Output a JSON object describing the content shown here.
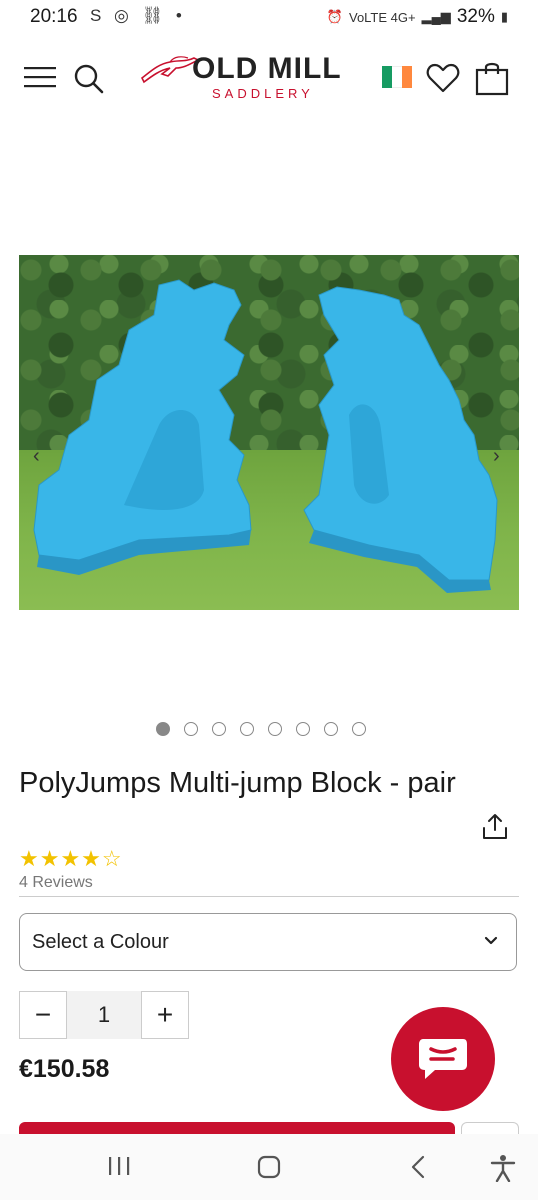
{
  "status_bar": {
    "time": "20:16",
    "left_icons": "S ◎ ⛓ •",
    "network": "VoLTE 4G+",
    "battery": "32%"
  },
  "header": {
    "logo_main": "OLD MILL",
    "logo_sub": "SADDLERY",
    "icons": [
      "menu-icon",
      "search-icon",
      "heart-icon",
      "bag-icon"
    ],
    "flag_colors": [
      "#169b62",
      "#ffffff",
      "#ff883e"
    ]
  },
  "gallery": {
    "dot_count": 8,
    "active_index": 0,
    "prev_label": "‹",
    "next_label": "›"
  },
  "product": {
    "title": "PolyJumps Multi-jump Block - pair",
    "rating_stars": "★★★★☆",
    "rating_value": 4,
    "reviews": "4 Reviews",
    "select_label": "Select a Colour",
    "quantity": "1",
    "minus_label": "−",
    "plus_label": "+",
    "price": "€150.58"
  },
  "colors": {
    "brand_red": "#c8102e",
    "block_blue": "#39b6e8",
    "star_yellow": "#f2c200"
  }
}
